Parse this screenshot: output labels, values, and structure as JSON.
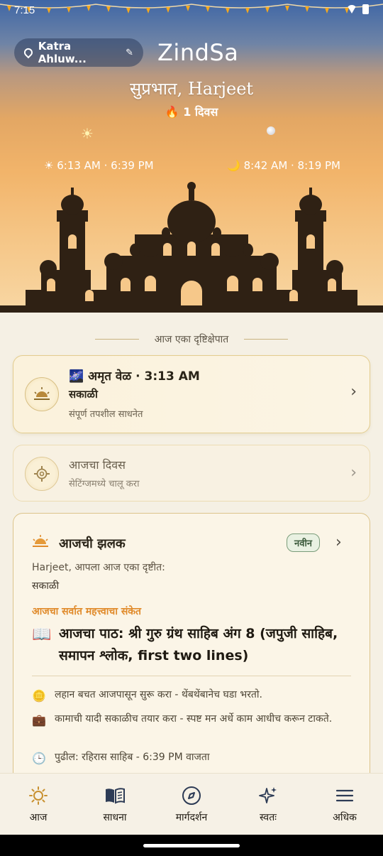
{
  "status_bar": {
    "time": "7:15"
  },
  "header": {
    "location": "Katra Ahluw...",
    "brand": "ZindSa",
    "greeting": "सुप्रभात, Harjeet",
    "streak": "🔥 1 दिवस",
    "sun_times": "☀ 6:13 AM · 6:39 PM",
    "moon_times": "🌙 8:42 AM · 8:19 PM"
  },
  "glance": {
    "title": "आज एका दृष्टिक्षेपात"
  },
  "amrit_card": {
    "title": "🌌 अमृत वेळ · 3:13 AM",
    "period": "सकाळी",
    "description": "संपूर्ण तपशील साधनेत"
  },
  "day_card": {
    "title": "आजचा दिवस",
    "description": "सेटिंग्जमध्ये चालू करा"
  },
  "zhalak": {
    "title": "आजची झलक",
    "badge": "नवीन",
    "intro": "Harjeet, आपला आज एका दृष्टीत:",
    "period": "सकाळी",
    "signal_label": "आजचा सर्वात महत्त्वाचा संकेत",
    "reading": "आजचा पाठ: श्री गुरु ग्रंथ साहिब अंग 8 (जपुजी साहिब, समापन श्लोक, first two lines)",
    "tips": [
      {
        "icon": "🪙",
        "text": "लहान बचत आजपासून सुरू करा - थेंबथेंबानेच घडा भरतो."
      },
      {
        "icon": "💼",
        "text": "कामाची यादी सकाळीच तयार करा - स्पष्ट मन अर्धे काम आधीच करून टाकते."
      },
      {
        "icon": "🕒",
        "text": "पुढील: रहिरास साहिब - 6:39 PM वाजता"
      }
    ]
  },
  "tabs": [
    {
      "label": "आज",
      "icon": "sun-icon",
      "active": true
    },
    {
      "label": "साधना",
      "icon": "book-icon",
      "active": false
    },
    {
      "label": "मार्गदर्शन",
      "icon": "compass-icon",
      "active": false
    },
    {
      "label": "स्वतः",
      "icon": "sparkles-icon",
      "active": false
    },
    {
      "label": "अधिक",
      "icon": "menu-icon",
      "active": false
    }
  ],
  "colors": {
    "accent": "#c8902f",
    "signal": "#e08a2a",
    "card_border": "#dcc48b",
    "background": "#f5f0e4"
  }
}
